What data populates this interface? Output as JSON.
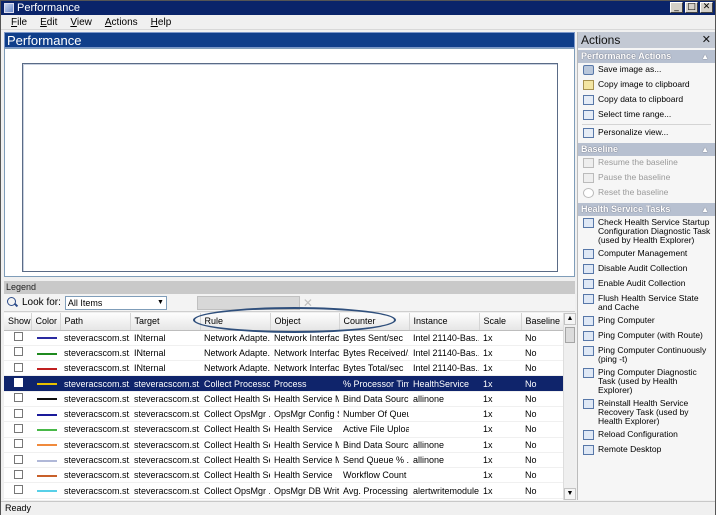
{
  "window": {
    "title": "Performance",
    "controls": [
      "_",
      "□",
      "✕"
    ]
  },
  "menu": [
    "File",
    "Edit",
    "View",
    "Actions",
    "Help"
  ],
  "main": {
    "header": "Performance"
  },
  "legend": {
    "header": "Legend",
    "look_for_label": "Look for:",
    "look_for_value": "All Items",
    "columns": [
      "Show",
      "Color",
      "Path",
      "Target",
      "Rule",
      "Object",
      "Counter",
      "Instance",
      "Scale",
      "Baseline"
    ],
    "rows": [
      {
        "color": "#2a2aa0",
        "path": "steveracscom.st...",
        "target": "INternal",
        "rule": "Network Adapte...",
        "object": "Network Interface",
        "counter": "Bytes Sent/sec",
        "instance": "Intel 21140-Bas...",
        "scale": "1x",
        "baseline": "No"
      },
      {
        "color": "#1f8a1f",
        "path": "steveracscom.st...",
        "target": "INternal",
        "rule": "Network Adapte...",
        "object": "Network Interface",
        "counter": "Bytes Received/...",
        "instance": "Intel 21140-Bas...",
        "scale": "1x",
        "baseline": "No"
      },
      {
        "color": "#c02020",
        "path": "steveracscom.st...",
        "target": "INternal",
        "rule": "Network Adapte...",
        "object": "Network Interface",
        "counter": "Bytes Total/sec",
        "instance": "Intel 21140-Bas...",
        "scale": "1x",
        "baseline": "No"
      },
      {
        "color": "#e8c000",
        "path": "steveracscom.st...",
        "target": "steveracscom.st...",
        "rule": "Collect Processo...",
        "object": "Process",
        "counter": "% Processor Time",
        "instance": "HealthService",
        "scale": "1x",
        "baseline": "No",
        "selected": true
      },
      {
        "color": "#111111",
        "path": "steveracscom.st...",
        "target": "steveracscom.st...",
        "rule": "Collect Health Se...",
        "object": "Health Service M...",
        "counter": "Bind Data Sourc...",
        "instance": "allinone",
        "scale": "1x",
        "baseline": "No"
      },
      {
        "color": "#1a1a9a",
        "path": "steveracscom.st...",
        "target": "steveracscom.st...",
        "rule": "Collect OpsMgr ...",
        "object": "OpsMgr Config S...",
        "counter": "Number Of Queu...",
        "instance": "",
        "scale": "1x",
        "baseline": "No"
      },
      {
        "color": "#48b848",
        "path": "steveracscom.st...",
        "target": "steveracscom.st...",
        "rule": "Collect Health Se...",
        "object": "Health Service",
        "counter": "Active File Uploads",
        "instance": "",
        "scale": "1x",
        "baseline": "No"
      },
      {
        "color": "#f08a3c",
        "path": "steveracscom.st...",
        "target": "steveracscom.st...",
        "rule": "Collect Health Se...",
        "object": "Health Service M...",
        "counter": "Bind Data Sourc...",
        "instance": "allinone",
        "scale": "1x",
        "baseline": "No"
      },
      {
        "color": "#b0b8d8",
        "path": "steveracscom.st...",
        "target": "steveracscom.st...",
        "rule": "Collect Health Se...",
        "object": "Health Service M...",
        "counter": "Send Queue % ...",
        "instance": "allinone",
        "scale": "1x",
        "baseline": "No"
      },
      {
        "color": "#c8602a",
        "path": "steveracscom.st...",
        "target": "steveracscom.st...",
        "rule": "Collect Health Se...",
        "object": "Health Service",
        "counter": "Workflow Count",
        "instance": "",
        "scale": "1x",
        "baseline": "No"
      },
      {
        "color": "#58d0e8",
        "path": "steveracscom.st...",
        "target": "steveracscom.st...",
        "rule": "Collect OpsMgr ...",
        "object": "OpsMgr DB Writ...",
        "counter": "Avg. Processing ...",
        "instance": "alertwritemodule",
        "scale": "1x",
        "baseline": "No"
      }
    ]
  },
  "status": "Ready",
  "actions": {
    "title": "Actions",
    "sections": [
      {
        "title": "Performance Actions",
        "items": [
          {
            "label": "Save image as...",
            "icon": "camera-icon",
            "style": "cam"
          },
          {
            "label": "Copy image to clipboard",
            "icon": "copy-icon",
            "style": "copy"
          },
          {
            "label": "Copy data to clipboard",
            "icon": "copy-data-icon",
            "style": ""
          },
          {
            "label": "Select time range...",
            "icon": "time-range-icon",
            "style": ""
          },
          {
            "label": "Personalize view...",
            "icon": "personalize-icon",
            "style": "",
            "sep_before": true
          }
        ]
      },
      {
        "title": "Baseline",
        "items": [
          {
            "label": "Resume the baseline",
            "icon": "resume-icon",
            "style": "",
            "disabled": true
          },
          {
            "label": "Pause the baseline",
            "icon": "pause-icon",
            "style": "",
            "disabled": true
          },
          {
            "label": "Reset the baseline",
            "icon": "reset-icon",
            "style": "clock",
            "disabled": true
          }
        ]
      },
      {
        "title": "Health Service Tasks",
        "items": [
          {
            "label": "Check Health Service Startup Configuration Diagnostic Task (used by Health Explorer)",
            "icon": "task-icon",
            "style": "task"
          },
          {
            "label": "Computer Management",
            "icon": "task-icon",
            "style": "task"
          },
          {
            "label": "Disable Audit Collection",
            "icon": "task-icon",
            "style": "task"
          },
          {
            "label": "Enable Audit Collection",
            "icon": "task-icon",
            "style": "task"
          },
          {
            "label": "Flush Health Service State and Cache",
            "icon": "task-icon",
            "style": "task"
          },
          {
            "label": "Ping Computer",
            "icon": "task-icon",
            "style": "task"
          },
          {
            "label": "Ping Computer (with Route)",
            "icon": "task-icon",
            "style": "task"
          },
          {
            "label": "Ping Computer Continuously (ping -t)",
            "icon": "task-icon",
            "style": "task"
          },
          {
            "label": "Ping Computer Diagnostic Task (used by Health Explorer)",
            "icon": "task-icon",
            "style": "task"
          },
          {
            "label": "Reinstall Health Service Recovery Task (used by Health Explorer)",
            "icon": "task-icon",
            "style": "task"
          },
          {
            "label": "Reload Configuration",
            "icon": "task-icon",
            "style": "task"
          },
          {
            "label": "Remote Desktop",
            "icon": "task-icon",
            "style": "task"
          }
        ]
      }
    ]
  }
}
